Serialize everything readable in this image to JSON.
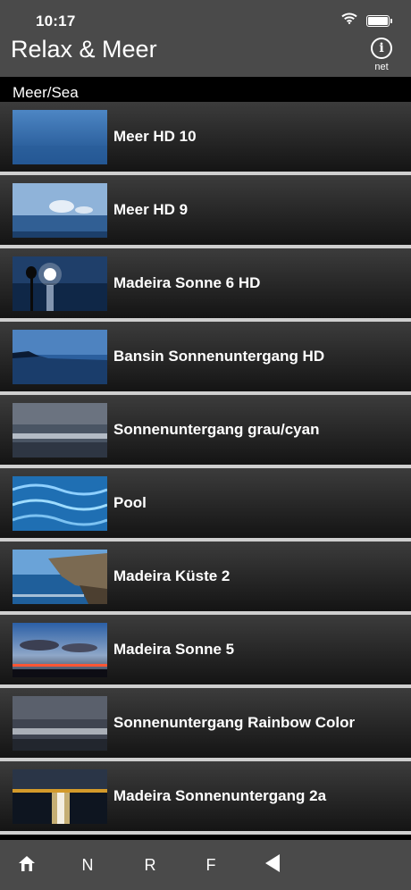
{
  "status": {
    "time": "10:17"
  },
  "header": {
    "title": "Relax & Meer",
    "info_label": "net"
  },
  "section": {
    "label": "Meer/Sea"
  },
  "items": [
    {
      "label": "Meer HD 10"
    },
    {
      "label": "Meer HD 9"
    },
    {
      "label": "Madeira Sonne 6 HD"
    },
    {
      "label": "Bansin Sonnenuntergang HD"
    },
    {
      "label": "Sonnenuntergang grau/cyan"
    },
    {
      "label": "Pool"
    },
    {
      "label": "Madeira Küste 2"
    },
    {
      "label": "Madeira Sonne 5"
    },
    {
      "label": "Sonnenuntergang Rainbow Color"
    },
    {
      "label": "Madeira Sonnenuntergang 2a"
    }
  ],
  "tabs": {
    "n": "N",
    "r": "R",
    "f": "F"
  }
}
